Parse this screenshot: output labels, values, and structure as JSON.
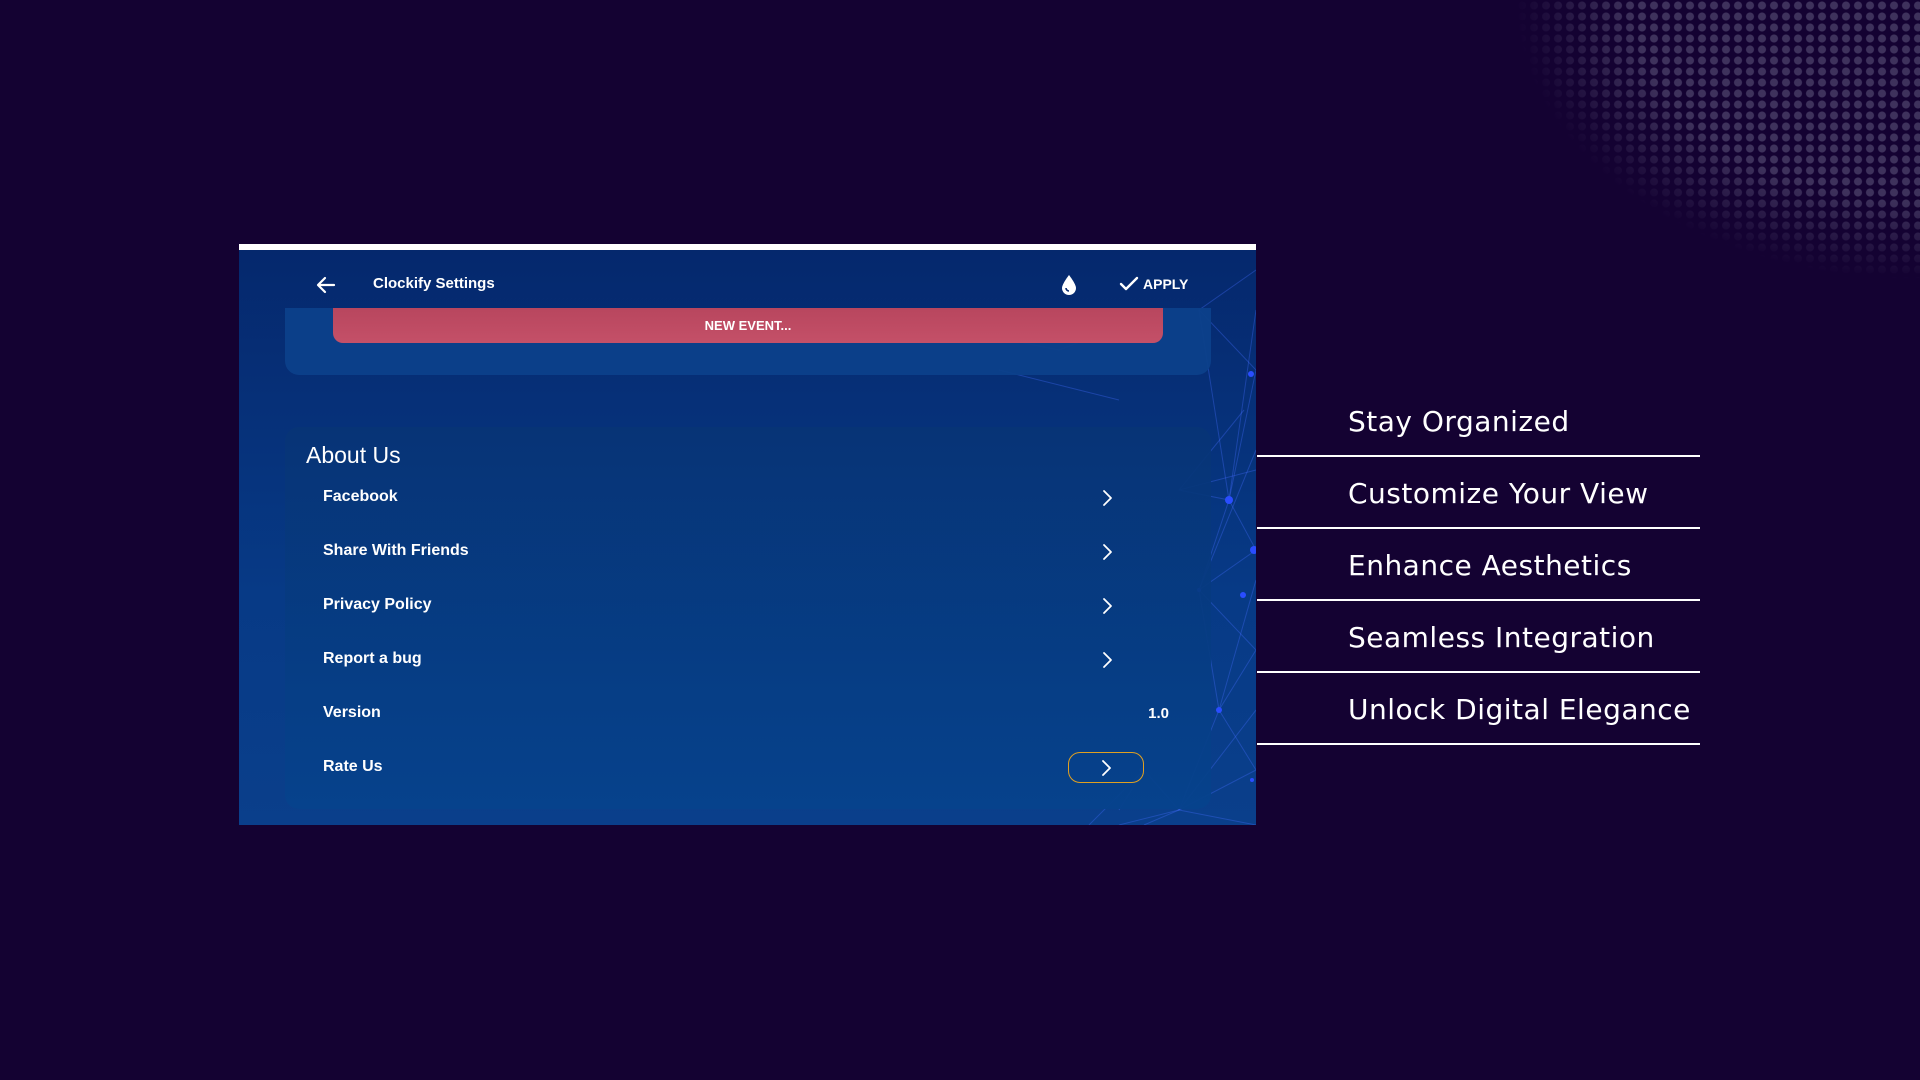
{
  "app": {
    "title": "Clockify Settings",
    "apply_label": "APPLY",
    "new_event_label": "NEW EVENT..."
  },
  "about": {
    "title": "About Us",
    "items": [
      {
        "label": "Facebook"
      },
      {
        "label": "Share With Friends"
      },
      {
        "label": "Privacy Policy"
      },
      {
        "label": "Report a bug"
      },
      {
        "label": "Version",
        "value": "1.0"
      },
      {
        "label": "Rate Us"
      }
    ]
  },
  "features": [
    "Stay Organized",
    "Customize Your View",
    "Enhance Aesthetics",
    "Seamless Integration",
    "Unlock Digital Elegance"
  ],
  "colors": {
    "background": "#140232",
    "app_background": "#073a86",
    "new_event": "#c14c64",
    "rate_border": "#e0a021"
  },
  "icons": [
    "arrow-left-icon",
    "water-drop-icon",
    "checkmark-icon",
    "chevron-right-icon"
  ]
}
